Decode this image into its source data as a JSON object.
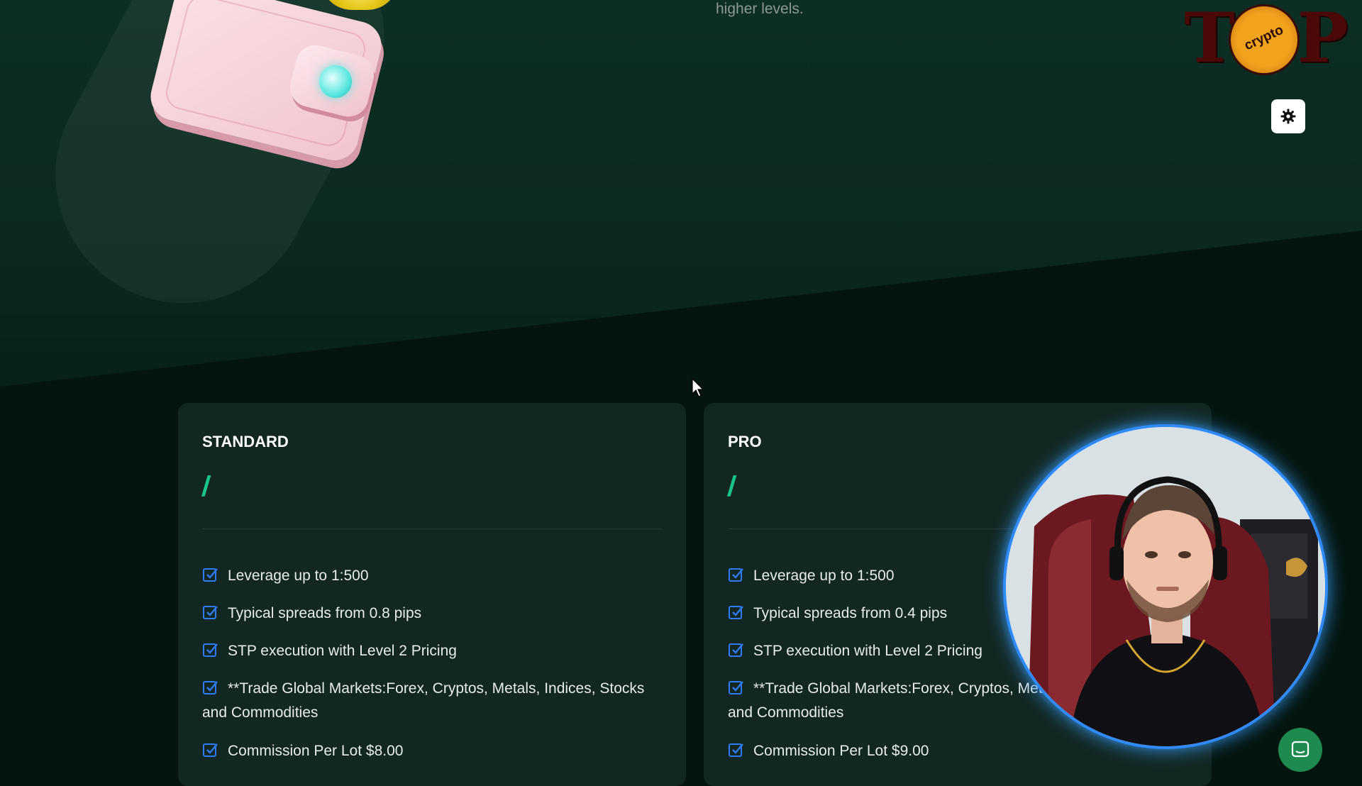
{
  "hero": {
    "tagline": "higher levels."
  },
  "logo": {
    "text": "TOP",
    "badge": "crypto"
  },
  "icons": {
    "theme_toggle": "gear-icon",
    "feature_check": "checkbox-checked-icon",
    "cursor": "mouse-pointer-icon",
    "chat": "chat-bubble-icon"
  },
  "colors": {
    "background": "#04150f",
    "card": "#122722",
    "accent": "#19c48a",
    "check": "#2f7cf6",
    "webcam_ring": "#2f8cff"
  },
  "plans": [
    {
      "name": "STANDARD",
      "price_mark": "/",
      "features": [
        "Leverage up to 1:500",
        "Typical spreads from 0.8 pips",
        "STP execution with Level 2 Pricing",
        "**Trade Global Markets:Forex, Cryptos, Metals, Indices, Stocks and Commodities",
        "Commission Per Lot $8.00"
      ]
    },
    {
      "name": "PRO",
      "price_mark": "/",
      "features": [
        "Leverage up to 1:500",
        "Typical spreads from 0.4 pips",
        "STP execution with Level 2 Pricing",
        "**Trade Global Markets:Forex, Cryptos, Metals, Indices, Stocks and Commodities",
        "Commission Per Lot $9.00"
      ]
    }
  ]
}
